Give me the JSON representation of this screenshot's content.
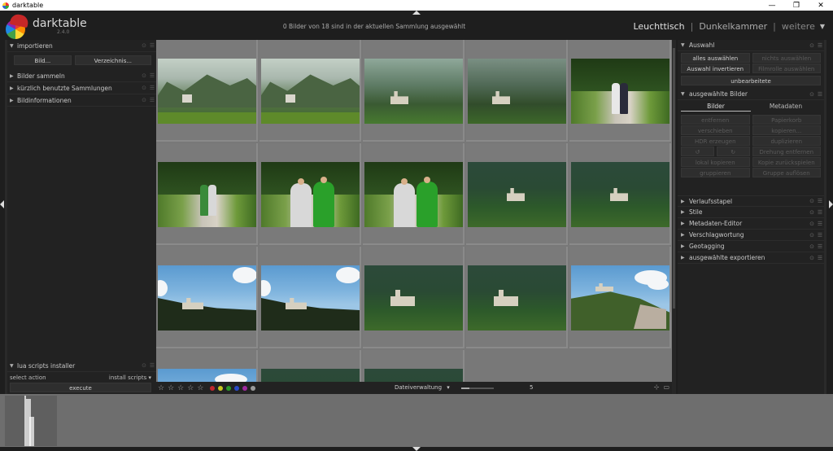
{
  "window": {
    "title": "darktable",
    "min": "—",
    "max": "❐",
    "close": "✕"
  },
  "header": {
    "app_name": "darktable",
    "version": "2.4.0",
    "status": "0 Bilder von 18 sind in der aktuellen Sammlung ausgewählt",
    "views": [
      {
        "label": "Leuchttisch",
        "active": true
      },
      {
        "label": "Dunkelkammer",
        "active": false
      },
      {
        "label": "weitere",
        "active": false
      }
    ],
    "sep": "|",
    "caret": "▼"
  },
  "left": {
    "import": {
      "title": "importieren",
      "btn_image": "Bild...",
      "btn_folder": "Verzeichnis..."
    },
    "modules": [
      "Bilder sammeln",
      "kürzlich benutzte Sammlungen",
      "Bildinformationen"
    ],
    "lua": {
      "title": "lua scripts installer",
      "select_label": "select action",
      "select_value": "install scripts",
      "execute": "execute"
    }
  },
  "bottom": {
    "stars": [
      "☆",
      "☆",
      "☆",
      "☆",
      "☆"
    ],
    "colors": [
      "#c0272d",
      "#c8c820",
      "#2a9a2a",
      "#2a4ac8",
      "#a02aa0",
      "#9a9a9a"
    ],
    "layout": "Dateiverwaltung",
    "zoom": "5"
  },
  "right": {
    "auswahl": {
      "title": "Auswahl",
      "buttons": [
        {
          "label": "alles auswählen",
          "enabled": true
        },
        {
          "label": "nichts auswählen",
          "enabled": false
        },
        {
          "label": "Auswahl invertieren",
          "enabled": true
        },
        {
          "label": "Filmrolle auswählen",
          "enabled": false
        }
      ],
      "untouched": "unbearbeitete"
    },
    "selected": {
      "title": "ausgewählte Bilder",
      "tab_images": "Bilder",
      "tab_meta": "Metadaten",
      "buttons": [
        "entfernen",
        "Papierkorb",
        "verschieben",
        "kopieren...",
        "HDR erzeugen",
        "duplizieren",
        "↺",
        "↻",
        "Drehung entfernen",
        "",
        "lokal kopieren",
        "Kopie zurückspielen",
        "gruppieren",
        "Gruppe auflösen"
      ]
    },
    "modules": [
      "Verlaufsstapel",
      "Stile",
      "Metadaten-Editor",
      "Verschlagwortung",
      "Geotagging",
      "ausgewählte exportieren"
    ]
  }
}
